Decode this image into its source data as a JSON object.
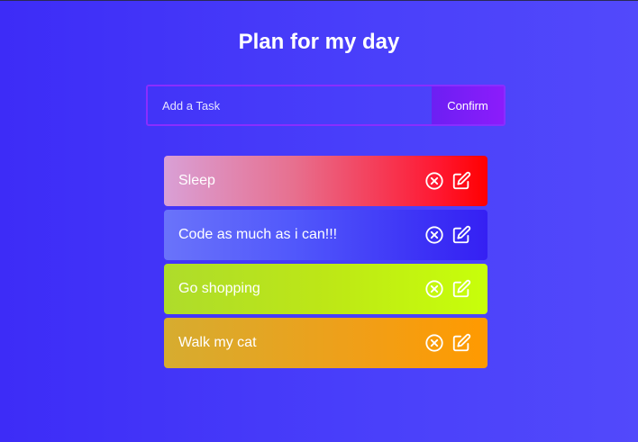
{
  "page": {
    "title": "Plan for my day"
  },
  "form": {
    "placeholder": "Add a Task",
    "value": "",
    "confirm_label": "Confirm"
  },
  "tasks": [
    {
      "label": "Sleep",
      "color": "#ff0000",
      "delete_icon": "circle-x-icon",
      "edit_icon": "edit-icon"
    },
    {
      "label": "Code as much as i can!!!",
      "color": "#3520f3",
      "delete_icon": "circle-x-icon",
      "edit_icon": "edit-icon"
    },
    {
      "label": "Go shopping",
      "color": "#c8ff0a",
      "delete_icon": "circle-x-icon",
      "edit_icon": "edit-icon"
    },
    {
      "label": "Walk my cat",
      "color": "#ff9a00",
      "delete_icon": "circle-x-icon",
      "edit_icon": "edit-icon"
    }
  ]
}
